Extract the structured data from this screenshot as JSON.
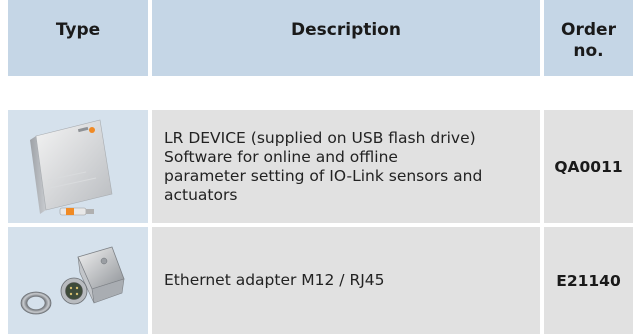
{
  "table": {
    "headers": {
      "type": "Type",
      "description": "Description",
      "order_no": "Order\nno."
    },
    "rows": [
      {
        "image_icon": "usb-software-package-icon",
        "description": "LR DEVICE (supplied on USB flash drive)\nSoftware for online and offline\nparameter setting of IO-Link sensors and\nactuators",
        "order_no": "QA0011"
      },
      {
        "image_icon": "ethernet-adapter-icon",
        "description": "Ethernet adapter M12 / RJ45",
        "order_no": "E21140"
      }
    ]
  },
  "colors": {
    "header_bg": "#c5d6e6",
    "image_cell_bg": "#d5e1ec",
    "data_cell_bg": "#e1e1e1"
  }
}
